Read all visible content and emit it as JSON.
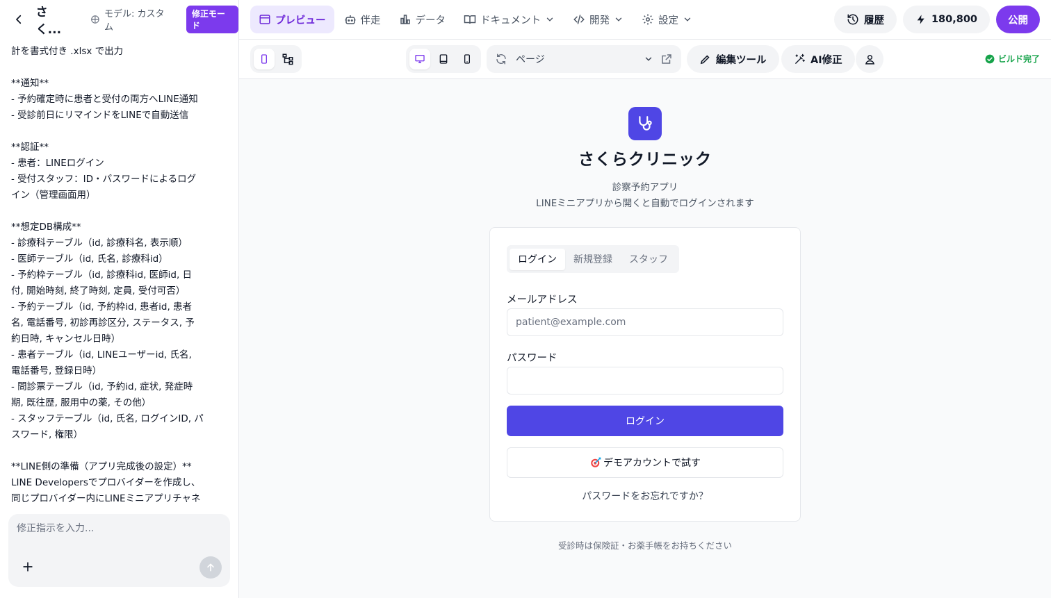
{
  "sidebar": {
    "project_title": "さく...",
    "model_label": "モデル: カスタム",
    "mode_badge": "修正モード",
    "chat_lines": [
      "計を書式付き .xlsx で出力",
      "",
      "**通知**",
      "- 予約確定時に患者と受付の両方へLINE通知",
      "- 受診前日にリマインドをLINEで自動送信",
      "",
      "**認証**",
      "- 患者：LINEログイン",
      "- 受付スタッフ：ID・パスワードによるログ",
      "イン（管理画面用）",
      "",
      "**想定DB構成**",
      "- 診療科テーブル（id, 診療科名, 表示順）",
      "- 医師テーブル（id, 氏名, 診療科id）",
      "- 予約枠テーブル（id, 診療科id, 医師id, 日",
      "付, 開始時刻, 終了時刻, 定員, 受付可否）",
      "- 予約テーブル（id, 予約枠id, 患者id, 患者",
      "名, 電話番号, 初診再診区分, ステータス, 予",
      "約日時, キャンセル日時）",
      "- 患者テーブル（id, LINEユーザーid, 氏名,",
      "電話番号, 登録日時）",
      "- 問診票テーブル（id, 予約id, 症状, 発症時",
      "期, 既往歴, 服用中の薬, その他）",
      "- スタッフテーブル（id, 氏名, ログインID, パ",
      "スワード, 権限）",
      "",
      "**LINE側の準備（アプリ完成後の設定）**",
      "LINE Developersでプロバイダーを作成し、",
      "同じプロバイダー内にLINEミニアプリチャネ"
    ],
    "composer_placeholder": "修正指示を入力..."
  },
  "topnav": {
    "tabs": [
      {
        "label": "プレビュー",
        "icon": "window-icon",
        "active": true
      },
      {
        "label": "伴走",
        "icon": "robot-icon",
        "active": false
      },
      {
        "label": "データ",
        "icon": "bar-chart-icon",
        "active": false
      },
      {
        "label": "ドキュメント",
        "icon": "book-icon",
        "active": false,
        "dropdown": true
      },
      {
        "label": "開発",
        "icon": "code-icon",
        "active": false,
        "dropdown": true
      },
      {
        "label": "設定",
        "icon": "gear-icon",
        "active": false,
        "dropdown": true
      }
    ],
    "history_label": "履歴",
    "credits_value": "180,800",
    "publish_label": "公開"
  },
  "toolbar": {
    "page_label": "ページ",
    "edit_tools_label": "編集ツール",
    "ai_fix_label": "AI修正",
    "build_status": "ビルド完了"
  },
  "preview": {
    "clinic_name": "さくらクリニック",
    "subtitle_1": "診察予約アプリ",
    "subtitle_2": "LINEミニアプリから開くと自動でログインされます",
    "tabs": [
      "ログイン",
      "新規登録",
      "スタッフ"
    ],
    "email_label": "メールアドレス",
    "email_placeholder": "patient@example.com",
    "password_label": "パスワード",
    "password_value": "",
    "login_button": "ログイン",
    "demo_button": "デモアカウントで試す",
    "forgot_link": "パスワードをお忘れですか？",
    "footer_note": "受診時は保険証・お薬手帳をお持ちください"
  },
  "colors": {
    "accent_purple": "#7c3aed",
    "primary_indigo": "#4f46e5",
    "success_green": "#16a34a"
  }
}
